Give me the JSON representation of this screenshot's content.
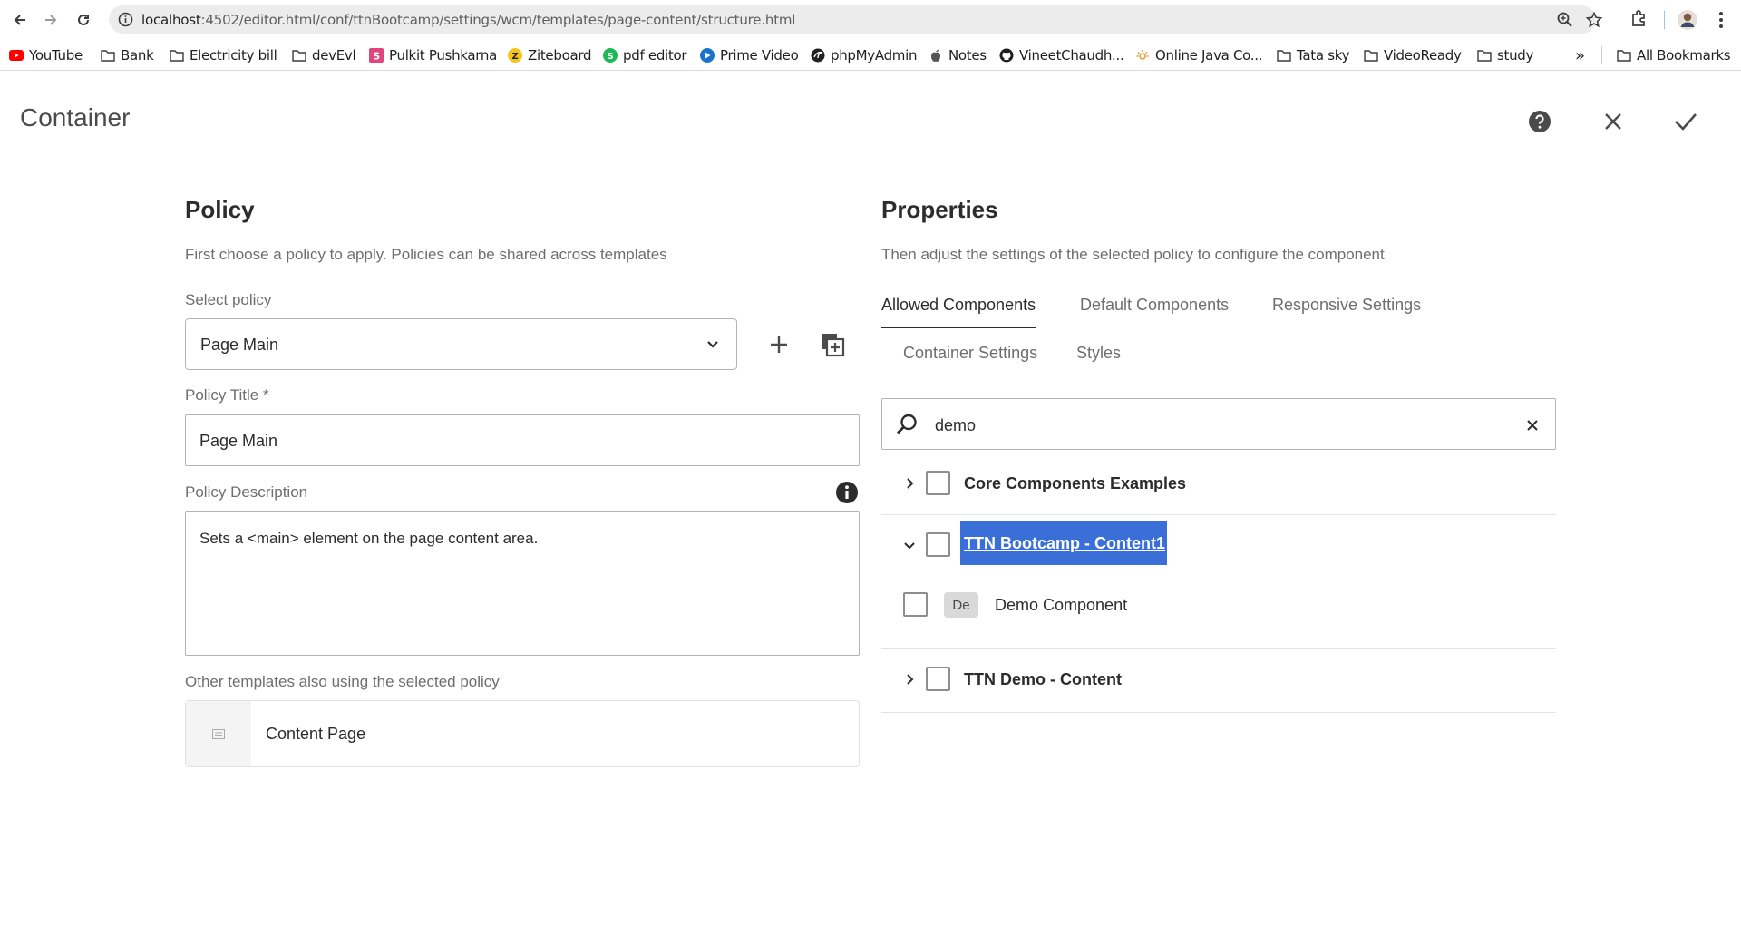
{
  "browser": {
    "url_host": "localhost",
    "url_rest": ":4502/editor.html/conf/ttnBootcamp/settings/wcm/templates/page-content/structure.html",
    "bookmarks": [
      {
        "label": "YouTube",
        "icon": "youtube-icon"
      },
      {
        "label": "Bank",
        "icon": "folder-icon"
      },
      {
        "label": "Electricity bill",
        "icon": "folder-icon"
      },
      {
        "label": "devEvl",
        "icon": "folder-icon"
      },
      {
        "label": "Pulkit Pushkarna",
        "icon": "site-s-icon"
      },
      {
        "label": "Ziteboard",
        "icon": "ziteboard-icon"
      },
      {
        "label": "pdf editor",
        "icon": "pdf-editor-icon"
      },
      {
        "label": "Prime Video",
        "icon": "prime-video-icon"
      },
      {
        "label": "phpMyAdmin",
        "icon": "phpmyadmin-icon"
      },
      {
        "label": "Notes",
        "icon": "apple-icon"
      },
      {
        "label": "VineetChaudh...",
        "icon": "github-icon"
      },
      {
        "label": "Online Java Co...",
        "icon": "sun-icon"
      },
      {
        "label": "Tata sky",
        "icon": "folder-icon"
      },
      {
        "label": "VideoReady",
        "icon": "folder-icon"
      },
      {
        "label": "study",
        "icon": "folder-icon"
      }
    ],
    "more_bookmarks": "»",
    "all_bookmarks": "All Bookmarks"
  },
  "dialog": {
    "title": "Container"
  },
  "policy": {
    "heading": "Policy",
    "description": "First choose a policy to apply. Policies can be shared across templates",
    "select_label": "Select policy",
    "select_value": "Page Main",
    "title_label": "Policy Title *",
    "title_value": "Page Main",
    "description_label": "Policy Description",
    "description_value": "Sets a <main> element on the page content area.",
    "other_templates_label": "Other templates also using the selected policy",
    "templates": [
      {
        "name": "Content Page"
      }
    ]
  },
  "properties": {
    "heading": "Properties",
    "description": "Then adjust the settings of the selected policy to configure the component",
    "tabs": [
      {
        "label": "Allowed Components",
        "active": true
      },
      {
        "label": "Default Components",
        "active": false
      },
      {
        "label": "Responsive Settings",
        "active": false
      },
      {
        "label": "Container Settings",
        "active": false
      },
      {
        "label": "Styles",
        "active": false
      }
    ],
    "search_value": "demo",
    "groups": [
      {
        "label": "Core Components Examples",
        "expanded": false,
        "selected": false
      },
      {
        "label": "TTN Bootcamp - Content1",
        "expanded": true,
        "selected": true,
        "components": [
          {
            "badge": "De",
            "label": "Demo Component"
          }
        ]
      },
      {
        "label": "TTN Demo - Content",
        "expanded": false,
        "selected": false
      }
    ]
  },
  "colors": {
    "accent": "#3a6fd8",
    "text": "#2c2c2c",
    "muted": "#6e6e6e"
  }
}
